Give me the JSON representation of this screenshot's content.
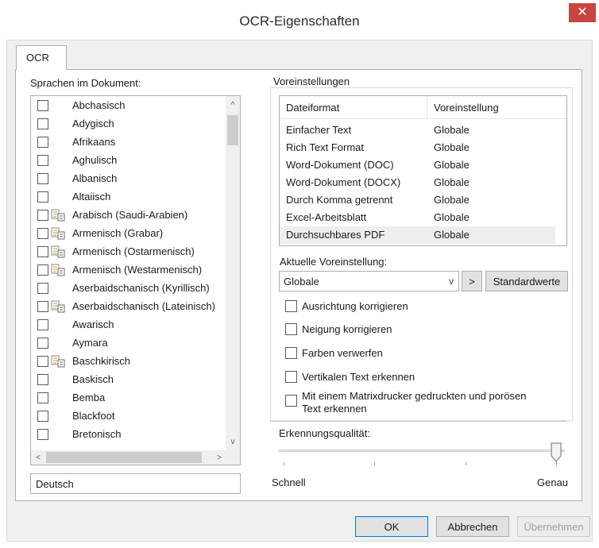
{
  "window": {
    "title": "OCR-Eigenschaften",
    "close_glyph": "✕"
  },
  "tab": {
    "label": "OCR"
  },
  "languages": {
    "label": "Sprachen im Dokument:",
    "items": [
      {
        "name": "Abchasisch",
        "icon": false
      },
      {
        "name": "Adygisch",
        "icon": false
      },
      {
        "name": "Afrikaans",
        "icon": false
      },
      {
        "name": "Aghulisch",
        "icon": false
      },
      {
        "name": "Albanisch",
        "icon": false
      },
      {
        "name": "Altaiisch",
        "icon": false
      },
      {
        "name": "Arabisch (Saudi-Arabien)",
        "icon": true
      },
      {
        "name": "Armenisch (Grabar)",
        "icon": true
      },
      {
        "name": "Armenisch (Ostarmenisch)",
        "icon": true
      },
      {
        "name": "Armenisch (Westarmenisch)",
        "icon": true
      },
      {
        "name": "Aserbaidschanisch (Kyrillisch)",
        "icon": false
      },
      {
        "name": "Aserbaidschanisch (Lateinisch)",
        "icon": true
      },
      {
        "name": "Awarisch",
        "icon": false
      },
      {
        "name": "Aymara",
        "icon": false
      },
      {
        "name": "Baschkirisch",
        "icon": true
      },
      {
        "name": "Baskisch",
        "icon": false
      },
      {
        "name": "Bemba",
        "icon": false
      },
      {
        "name": "Blackfoot",
        "icon": false
      },
      {
        "name": "Bretonisch",
        "icon": false
      }
    ],
    "scroll_up": "^",
    "scroll_down": "v",
    "scroll_left": "<",
    "scroll_right": ">",
    "selected_value": "Deutsch"
  },
  "presets": {
    "group_label": "Voreinstellungen",
    "table": {
      "columns": [
        "Dateiformat",
        "Voreinstellung"
      ],
      "rows": [
        [
          "Einfacher Text",
          "Globale"
        ],
        [
          "Rich Text Format",
          "Globale"
        ],
        [
          "Word-Dokument (DOC)",
          "Globale"
        ],
        [
          "Word-Dokument (DOCX)",
          "Globale"
        ],
        [
          "Durch Komma getrennt",
          "Globale"
        ],
        [
          "Excel-Arbeitsblatt",
          "Globale"
        ],
        [
          "Durchsuchbares PDF",
          "Globale"
        ]
      ],
      "selected_row_index": 6
    },
    "current_label": "Aktuelle Voreinstellung:",
    "current_value": "Globale",
    "dropdown_glyph": "v",
    "arrow_button": ">",
    "defaults_button": "Standardwerte",
    "options": [
      {
        "label": "Ausrichtung korrigieren",
        "checked": false
      },
      {
        "label": "Neigung korrigieren",
        "checked": false
      },
      {
        "label": "Farben verwerfen",
        "checked": false
      },
      {
        "label": "Vertikalen Text erkennen",
        "checked": false
      },
      {
        "label_line1": "Mit einem Matrixdrucker gedruckten und porösen",
        "label_line2": "Text erkennen",
        "checked": false
      }
    ],
    "quality": {
      "label": "Erkennungsqualität:",
      "min_label": "Schnell",
      "max_label": "Genau",
      "value_fraction": 1.0
    }
  },
  "footer": {
    "ok": "OK",
    "cancel": "Abbrechen",
    "apply": "Übernehmen",
    "apply_enabled": false
  },
  "colors": {
    "close_button": "#c7463f",
    "selected_row": "#eeeeee",
    "disabled_text": "#a0a0a0"
  }
}
